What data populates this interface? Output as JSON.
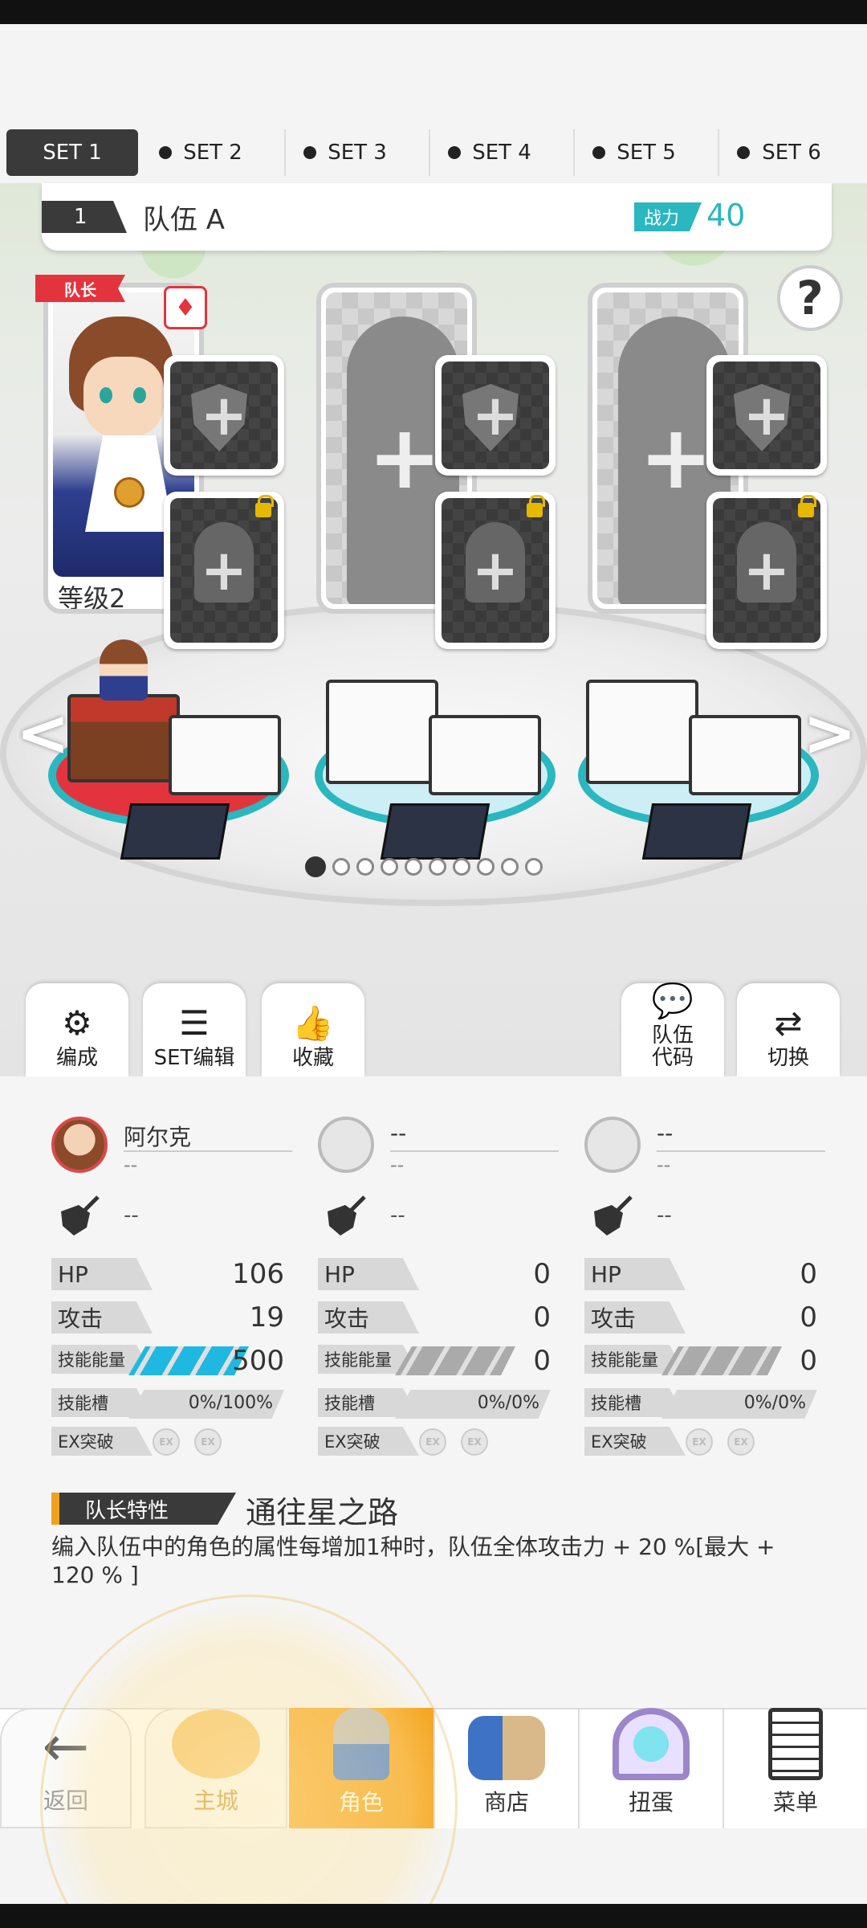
{
  "set_tabs": [
    "SET 1",
    "SET 2",
    "SET 3",
    "SET 4",
    "SET 5",
    "SET 6"
  ],
  "active_set": 0,
  "team": {
    "number": "1",
    "name": "队伍 A",
    "power_label": "战力",
    "power_value": "40"
  },
  "help_label": "?",
  "leader_flag": "队长",
  "leader_level": "等级2",
  "leader_attr_icon": "♦",
  "pager": {
    "total": 10,
    "current": 1
  },
  "actions": {
    "formation": "编成",
    "set_edit": "SET编辑",
    "favorite": "收藏",
    "team_code": "队伍\n代码",
    "switch": "切换"
  },
  "members": [
    {
      "name": "阿尔克",
      "sub": "--",
      "weapon": "--",
      "hp_label": "HP",
      "hp": "106",
      "atk_label": "攻击",
      "atk": "19",
      "energy_label": "技能能量",
      "energy": "500",
      "energy_active": true,
      "slot_label": "技能槽",
      "slot": "0%/100%",
      "ex_label": "EX突破"
    },
    {
      "name": "--",
      "sub": "--",
      "weapon": "--",
      "hp_label": "HP",
      "hp": "0",
      "atk_label": "攻击",
      "atk": "0",
      "energy_label": "技能能量",
      "energy": "0",
      "energy_active": false,
      "slot_label": "技能槽",
      "slot": "0%/0%",
      "ex_label": "EX突破"
    },
    {
      "name": "--",
      "sub": "--",
      "weapon": "--",
      "hp_label": "HP",
      "hp": "0",
      "atk_label": "攻击",
      "atk": "0",
      "energy_label": "技能能量",
      "energy": "0",
      "energy_active": false,
      "slot_label": "技能槽",
      "slot": "0%/0%",
      "ex_label": "EX突破"
    }
  ],
  "ex_badge": "EX",
  "leader_trait": {
    "label": "队长特性",
    "name": "通往星之路",
    "description": "编入队伍中的角色的属性每增加1种时，队伍全体攻击力 + 20 %[最大 + 120 % ]"
  },
  "nav": {
    "back": "返回",
    "items": [
      "主城",
      "角色",
      "商店",
      "扭蛋",
      "菜单"
    ],
    "active": 1
  },
  "colors": {
    "accent_orange": "#f5a623",
    "teal": "#2ab7c0",
    "leader_red": "#e3343e",
    "energy_blue": "#1fb8e0"
  }
}
